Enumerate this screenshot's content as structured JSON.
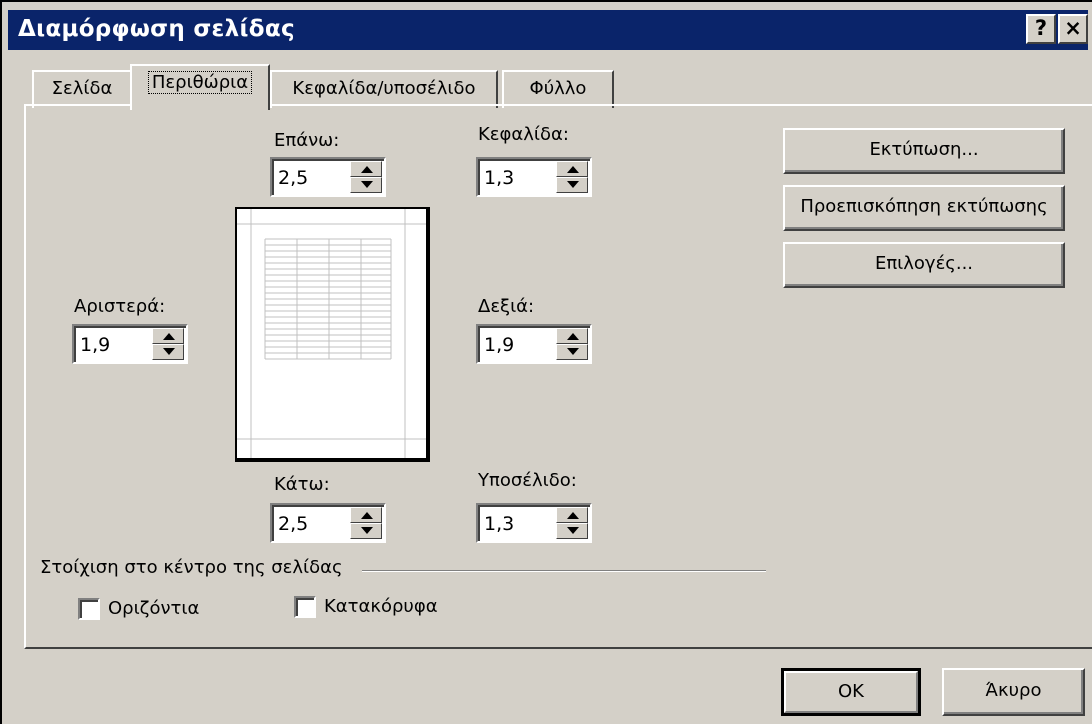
{
  "window": {
    "title": "Διαμόρφωση σελίδας",
    "help_label": "?",
    "close_label": "×"
  },
  "tabs": [
    {
      "label": "Σελίδα"
    },
    {
      "label": "Περιθώρια"
    },
    {
      "label": "Κεφαλίδα/υποσέλιδο"
    },
    {
      "label": "Φύλλο"
    }
  ],
  "margins": {
    "top": {
      "label": "Επάνω:",
      "value": "2,5"
    },
    "header": {
      "label": "Κεφαλίδα:",
      "value": "1,3"
    },
    "left": {
      "label": "Αριστερά:",
      "value": "1,9"
    },
    "right": {
      "label": "Δεξιά:",
      "value": "1,9"
    },
    "bottom": {
      "label": "Κάτω:",
      "value": "2,5"
    },
    "footer": {
      "label": "Υποσέλιδο:",
      "value": "1,3"
    }
  },
  "center": {
    "group_label": "Στοίχιση στο κέντρο της σελίδας",
    "horizontal_label": "Οριζόντια",
    "vertical_label": "Κατακόρυφα"
  },
  "side_buttons": {
    "print": "Εκτύπωση...",
    "preview": "Προεπισκόπηση εκτύπωσης",
    "options": "Επιλογές..."
  },
  "footer_buttons": {
    "ok": "OK",
    "cancel": "Άκυρο"
  }
}
